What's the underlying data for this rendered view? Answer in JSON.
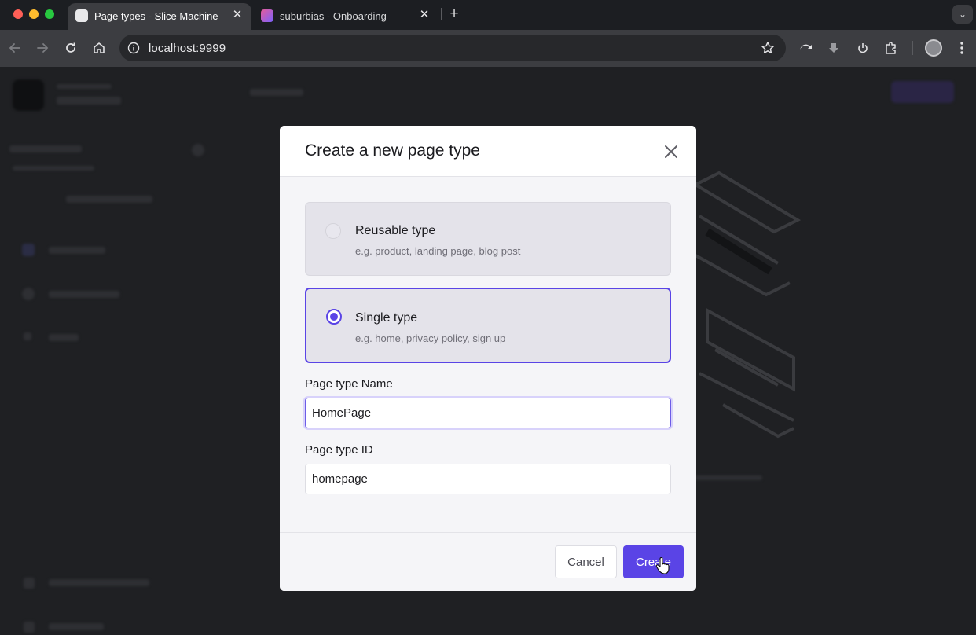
{
  "browser": {
    "tabs": [
      {
        "title": "Page types - Slice Machine",
        "active": true
      },
      {
        "title": "suburbias - Onboarding",
        "active": false
      }
    ],
    "url": "localhost:9999",
    "icons": [
      "back-icon",
      "forward-icon",
      "reload-icon",
      "home-icon",
      "info-icon",
      "star-icon",
      "extension-icons",
      "profile-avatar",
      "menu-icon"
    ]
  },
  "modal": {
    "title": "Create a new page type",
    "options": [
      {
        "label": "Reusable type",
        "description": "e.g. product, landing page, blog post",
        "selected": false
      },
      {
        "label": "Single type",
        "description": "e.g. home, privacy policy, sign up",
        "selected": true
      }
    ],
    "name_label": "Page type Name",
    "name_value": "HomePage",
    "id_label": "Page type ID",
    "id_value": "homepage",
    "cancel_label": "Cancel",
    "create_label": "Create"
  },
  "colors": {
    "accent": "#5a44e6",
    "modal_bg": "#f5f5f8",
    "overlay": "#1f2023"
  }
}
